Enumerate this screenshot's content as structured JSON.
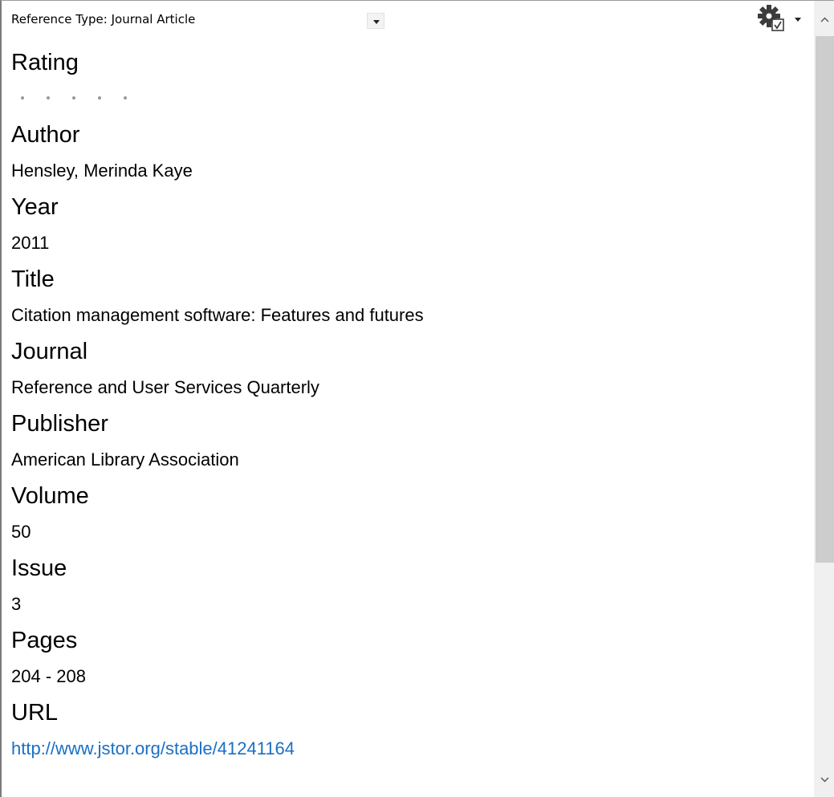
{
  "reference_type": {
    "label": "Reference Type:",
    "value": "Journal Article"
  },
  "toolbar": {
    "settings_icon": "gear-check-icon"
  },
  "rating": {
    "label": "Rating",
    "stars_total": 5,
    "stars_filled": 0
  },
  "fields": [
    {
      "label": "Author",
      "value": "Hensley, Merinda Kaye"
    },
    {
      "label": "Year",
      "value": "2011"
    },
    {
      "label": "Title",
      "value": "Citation management software: Features and futures"
    },
    {
      "label": "Journal",
      "value": "Reference and User Services Quarterly"
    },
    {
      "label": "Publisher",
      "value": "American Library Association"
    },
    {
      "label": "Volume",
      "value": "50"
    },
    {
      "label": "Issue",
      "value": "3"
    },
    {
      "label": "Pages",
      "value": "204 - 208"
    },
    {
      "label": "URL",
      "value": "http://www.jstor.org/stable/41241164"
    }
  ],
  "colors": {
    "link": "#1a6fc4",
    "scrollbar_track": "#f0f0f0",
    "scrollbar_thumb": "#cdcdcd"
  }
}
